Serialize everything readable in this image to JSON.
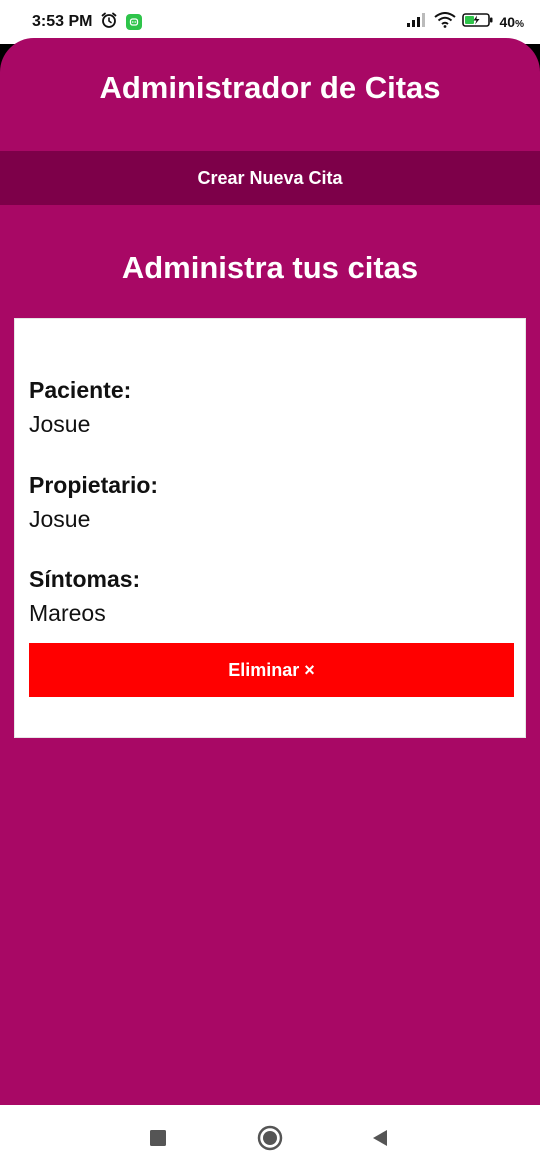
{
  "status_bar": {
    "time": "3:53 PM",
    "battery_percent": "40",
    "battery_suffix": "%",
    "icons": [
      "alarm-icon",
      "app-notification-icon",
      "signal-icon",
      "wifi-icon",
      "battery-charging-icon"
    ]
  },
  "header": {
    "title": "Administrador de Citas"
  },
  "new_appointment_button": {
    "label": "Crear Nueva Cita"
  },
  "section": {
    "title": "Administra tus citas"
  },
  "appointment": {
    "patient_label": "Paciente:",
    "patient_value": "Josue",
    "owner_label": "Propietario:",
    "owner_value": "Josue",
    "symptoms_label": "Síntomas:",
    "symptoms_value": "Mareos",
    "delete_label": "Eliminar ×"
  },
  "colors": {
    "app_background": "#a80865",
    "button_bar": "#7d0049",
    "delete_button": "#ff0000"
  },
  "nav_bar": {
    "icons": [
      "recent-apps-icon",
      "home-icon",
      "back-icon"
    ]
  }
}
